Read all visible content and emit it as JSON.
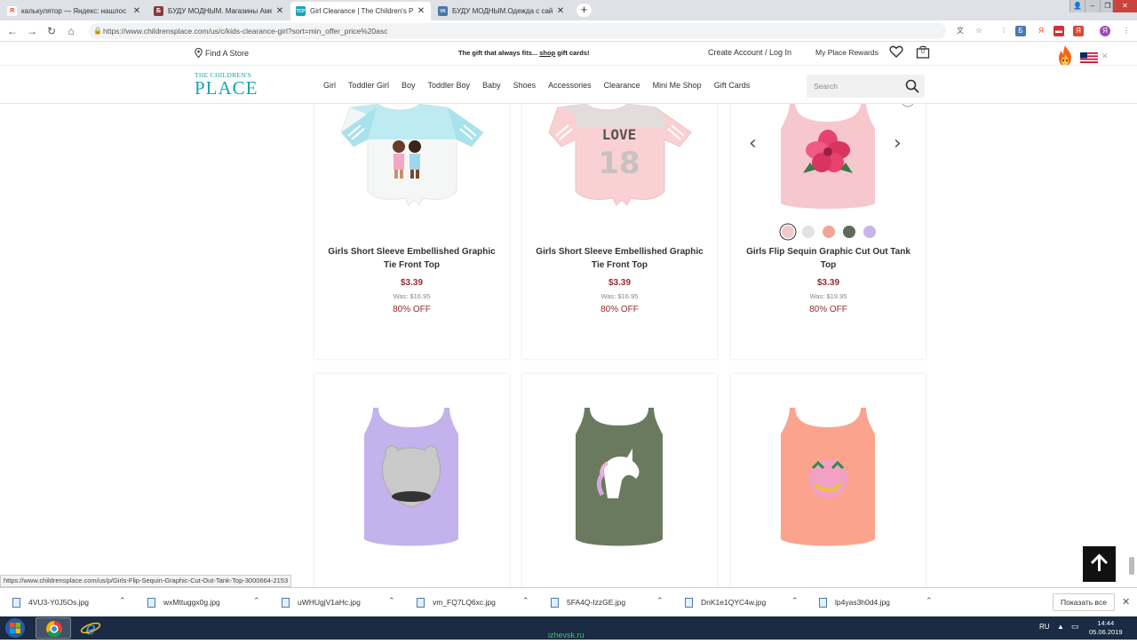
{
  "browser": {
    "tabs": [
      {
        "title": "калькулятор — Яндекс: нашлос",
        "favicon": "Я",
        "color": "#fc3f1d"
      },
      {
        "title": "БУДУ МОДНЫМ. Магазины Аме",
        "favicon": "Б",
        "color": "#8b3a3a"
      },
      {
        "title": "Girl Clearance | The Children's Pl",
        "favicon": "TCP",
        "color": "#1aa3b8"
      },
      {
        "title": "БУДУ МОДНЫМ.Одежда с сайт",
        "favicon": "VK",
        "color": "#4a76a8"
      }
    ],
    "new_tab": "+",
    "url": "https://www.childrensplace.com/us/c/kids-clearance-girl?sort=min_offer_price%20asc"
  },
  "header": {
    "find_store": "Find A Store",
    "promo_text": "The gift that always fits... ",
    "promo_link": "shop",
    "promo_tail": " gift cards!",
    "account": "Create Account  /  Log In",
    "rewards": "My Place Rewards",
    "bag_count": "0"
  },
  "nav": {
    "logo_line1": "THE CHILDREN'S",
    "logo_line2": "PLACE",
    "menu": [
      "Girl",
      "Toddler Girl",
      "Boy",
      "Toddler Boy",
      "Baby",
      "Shoes",
      "Accessories",
      "Clearance",
      "Mini Me Shop",
      "Gift Cards"
    ],
    "search_placeholder": "Search"
  },
  "products": [
    {
      "name": "Girls Short Sleeve Embellished Graphic Tie Front Top",
      "price": "$3.39",
      "was": "Was: $16.95",
      "off": "80% OFF"
    },
    {
      "name": "Girls Short Sleeve Embellished Graphic Tie Front Top",
      "price": "$3.39",
      "was": "Was: $16.95",
      "off": "80% OFF"
    },
    {
      "name": "Girls Flip Sequin Graphic Cut Out Tank Top",
      "price": "$3.39",
      "was": "Was: $19.95",
      "off": "80% OFF"
    }
  ],
  "swatch_colors": [
    "#f2c9c9",
    "#e2e2e2",
    "#f0a696",
    "#5e6b58",
    "#c6b5ea"
  ],
  "product_graphic": {
    "love_text": "LOVE",
    "number_text": "18"
  },
  "status_url": "https://www.childrensplace.com/us/p/Girls-Flip-Sequin-Graphic-Cut-Out-Tank-Top-3000664-2153",
  "downloads": {
    "files": [
      "4VU3-Y0J5Os.jpg",
      "wxMttuggx0g.jpg",
      "uWHUgjV1aHc.jpg",
      "vm_FQ7LQ6xc.jpg",
      "5FA4Q-IzzGE.jpg",
      "DnK1e1QYC4w.jpg",
      "lp4yas3h0d4.jpg"
    ],
    "show_all": "Показать все"
  },
  "taskbar": {
    "watermark": "izhevsk.ru",
    "lang": "RU",
    "time": "14:44",
    "date": "05.06.2019"
  }
}
